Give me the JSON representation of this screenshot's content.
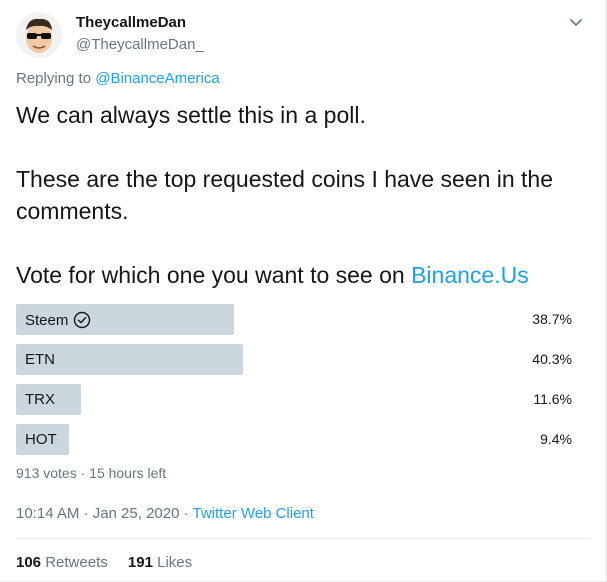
{
  "author": {
    "display_name": "TheycallmeDan",
    "handle": "@TheycallmeDan_"
  },
  "reply": {
    "prefix": "Replying to",
    "mention": "@BinanceAmerica"
  },
  "tweet": {
    "line1": "We can always settle this in a poll.",
    "line2a": "These are the top requested coins I have seen in the",
    "line2b": "comments.",
    "line3_text": "Vote for which one you want to see on",
    "line3_link": "Binance.Us"
  },
  "poll": {
    "options": [
      {
        "label": "Steem",
        "percent_label": "38.7%",
        "percent": 38.7,
        "selected": true
      },
      {
        "label": "ETN",
        "percent_label": "40.3%",
        "percent": 40.3,
        "selected": false
      },
      {
        "label": "TRX",
        "percent_label": "11.6%",
        "percent": 11.6,
        "selected": false
      },
      {
        "label": "HOT",
        "percent_label": "9.4%",
        "percent": 9.4,
        "selected": false
      }
    ],
    "meta": "913 votes · 15 hours left"
  },
  "timestamp": {
    "time": "10:14 AM · Jan 25, 2020 · ",
    "client": "Twitter Web Client"
  },
  "stats": {
    "retweets_count": "106",
    "retweets_label": "Retweets",
    "likes_count": "191",
    "likes_label": "Likes"
  },
  "colors": {
    "link": "#1da1f2",
    "bar": "#ccd6dd",
    "secondary_text": "#657786"
  }
}
